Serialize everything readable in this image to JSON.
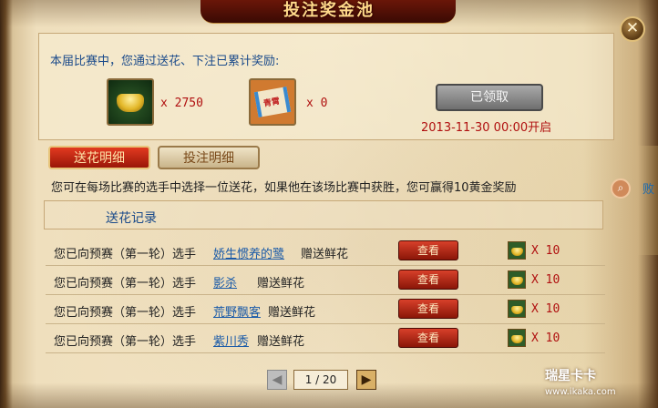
{
  "window": {
    "title": "投注奖金池",
    "close_glyph": "✕"
  },
  "rewards": {
    "intro": "本届比赛中，您通过送花、下注已累计奖励:",
    "items": [
      {
        "icon": "gold-ingot-icon",
        "count": "x 2750"
      },
      {
        "icon": "scroll-icon",
        "icon_text": "青霄",
        "count": "x 0"
      }
    ],
    "claim_button": "已领取",
    "open_time": "2013-11-30 00:00开启"
  },
  "tabs": [
    {
      "label": "送花明细",
      "active": true
    },
    {
      "label": "投注明细",
      "active": false
    }
  ],
  "tip": "您可在每场比赛的选手中选择一位送花，如果他在该场比赛中获胜，您可赢得10黄金奖励",
  "records": {
    "header": "送花记录",
    "rows": [
      {
        "prefix": "您已向预赛（第一轮）选手",
        "player": "娇生惯养的鹭",
        "suffix": "赠送鲜花",
        "view": "查看",
        "count": "X 10"
      },
      {
        "prefix": "您已向预赛（第一轮）选手",
        "player": "影杀",
        "suffix": "赠送鲜花",
        "view": "查看",
        "count": "X 10"
      },
      {
        "prefix": "您已向预赛（第一轮）选手",
        "player": "荒野飘客",
        "suffix": "赠送鲜花",
        "view": "查看",
        "count": "X 10"
      },
      {
        "prefix": "您已向预赛（第一轮）选手",
        "player": "紫川秀",
        "suffix": "赠送鲜花",
        "view": "查看",
        "count": "X 10"
      }
    ]
  },
  "pager": {
    "prev": "◀",
    "display": "1 / 20",
    "next": "▶"
  },
  "side": {
    "text": "败"
  },
  "watermark": {
    "name": "瑞星卡卡",
    "site": "www.ikaka.com"
  }
}
